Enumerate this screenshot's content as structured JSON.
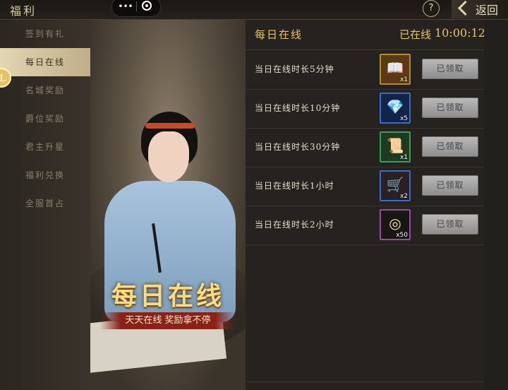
{
  "header": {
    "title": "福利",
    "help_label": "?",
    "back_label": "返回"
  },
  "sidebar": {
    "items": [
      {
        "label": "签到有礼"
      },
      {
        "label": "每日在线"
      },
      {
        "label": "名城奖励"
      },
      {
        "label": "爵位奖励"
      },
      {
        "label": "君主升星"
      },
      {
        "label": "福利兑换"
      },
      {
        "label": "全服首占"
      }
    ],
    "active": "每日在线",
    "bubble_text": "L"
  },
  "banner": {
    "title": "每日在线",
    "subtitle": "天天在线 奖励拿不停"
  },
  "panel": {
    "title": "每日在线",
    "online_label": "已在线",
    "online_time": "10:00:12",
    "rows": [
      {
        "label": "当日在线时长5分钟",
        "item_icon": "book-icon",
        "item_qty": "x1",
        "button_label": "已领取",
        "border_color": "#b08a3a",
        "bg_color": "#5a3a12"
      },
      {
        "label": "当日在线时长10分钟",
        "item_icon": "gem-pouch-icon",
        "item_qty": "x5",
        "button_label": "已领取",
        "border_color": "#3a6bc8",
        "bg_color": "#12244a"
      },
      {
        "label": "当日在线时长30分钟",
        "item_icon": "scroll-chest-icon",
        "item_qty": "x1",
        "button_label": "已领取",
        "border_color": "#3f9a54",
        "bg_color": "#1d3a22"
      },
      {
        "label": "当日在线时长1小时",
        "item_icon": "supply-cart-icon",
        "item_qty": "x2",
        "button_label": "已领取",
        "border_color": "#3a6bc8",
        "bg_color": "#2a1f24"
      },
      {
        "label": "当日在线时长2小时",
        "item_icon": "coin-icon",
        "item_qty": "x50",
        "button_label": "已领取",
        "border_color": "#9a4aa8",
        "bg_color": "#1a1614"
      }
    ]
  }
}
